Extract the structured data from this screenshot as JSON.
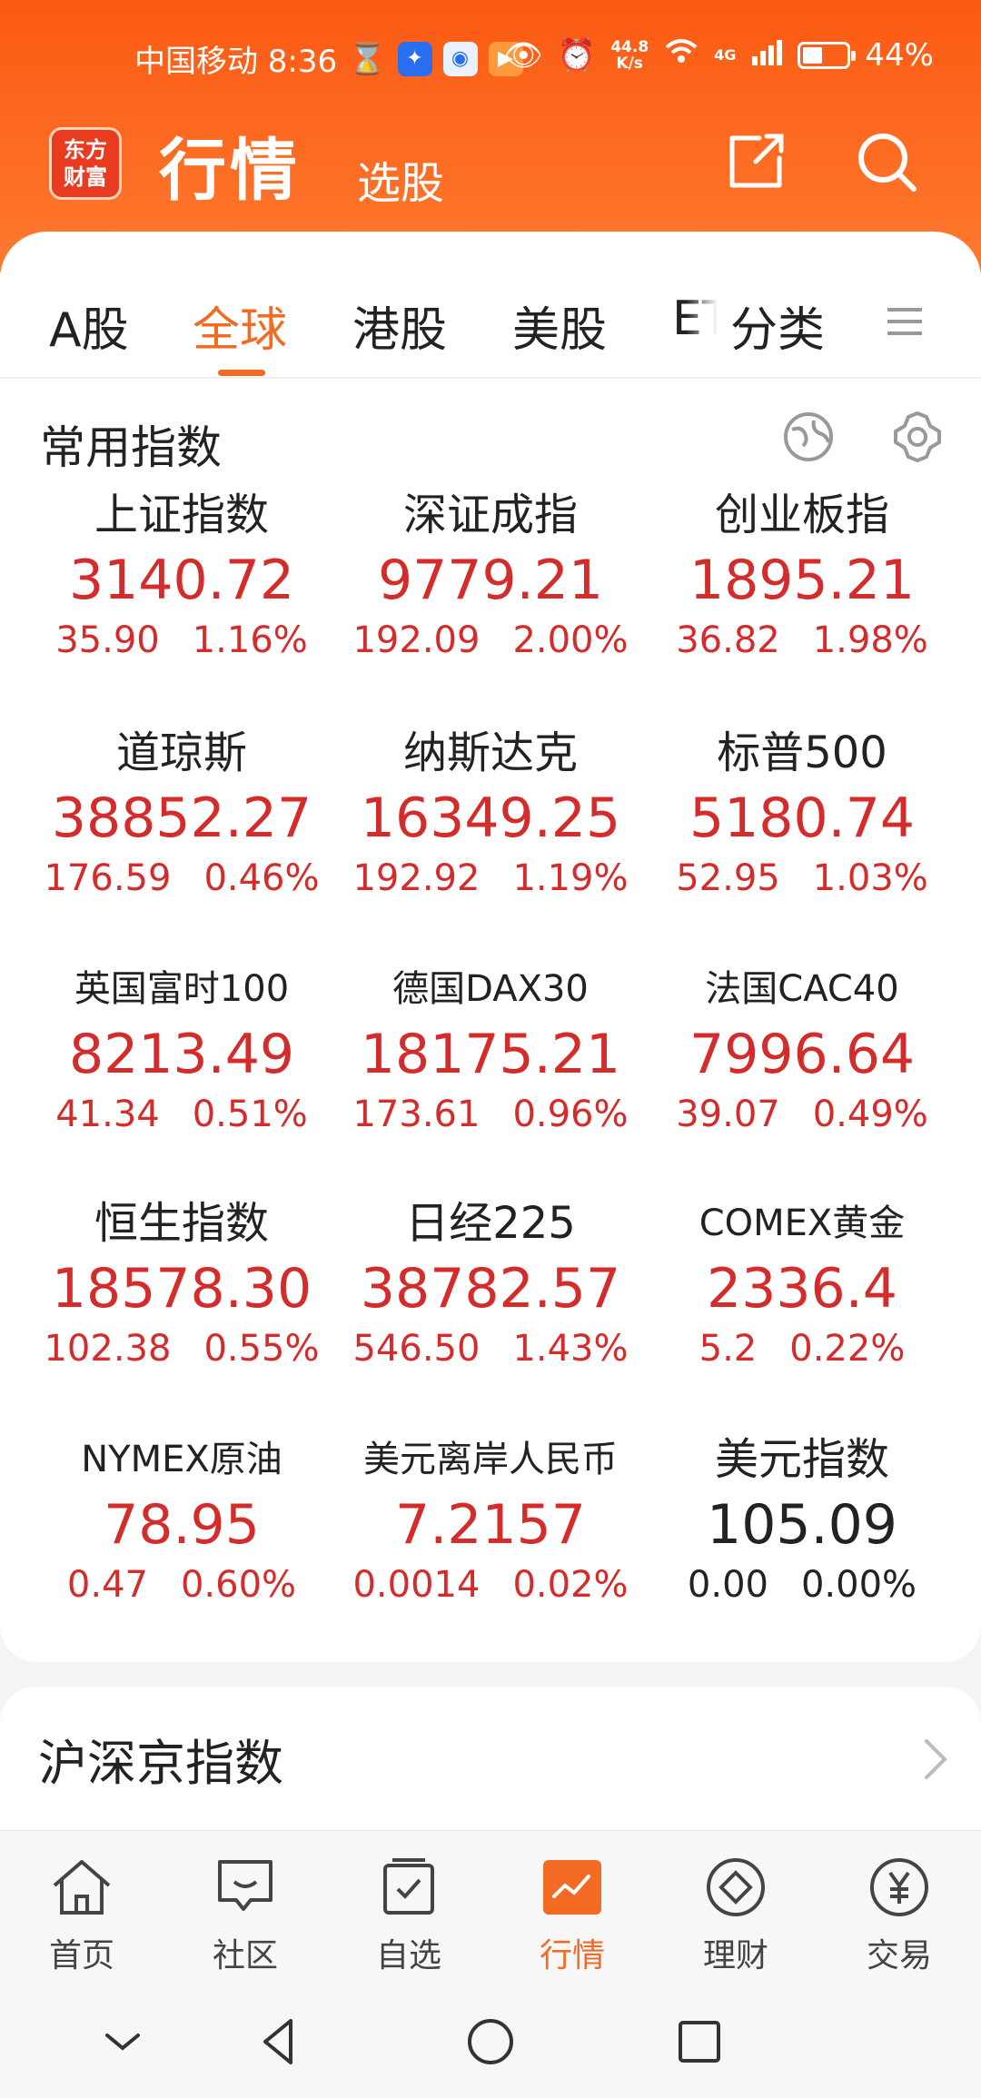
{
  "status_bar": {
    "carrier_time": "中国移动 8:36",
    "net_speed_value": "44.8",
    "net_speed_unit": "K/s",
    "network": "4G",
    "battery": "44%",
    "battery_level": 0.44
  },
  "header": {
    "logo_line1": "东方",
    "logo_line2": "财富",
    "title": "行情",
    "subtitle": "选股",
    "share_icon": "share-icon",
    "search_icon": "search-icon"
  },
  "tabs": [
    {
      "label": "A股",
      "active": false
    },
    {
      "label": "全球",
      "active": true
    },
    {
      "label": "港股",
      "active": false
    },
    {
      "label": "美股",
      "active": false
    },
    {
      "label": "ET",
      "active": false
    },
    {
      "label": "分类",
      "active": false
    }
  ],
  "section": {
    "title": "常用指数",
    "globe_icon": "globe-icon",
    "settings_icon": "gear-icon"
  },
  "indices": [
    {
      "name": "上证指数",
      "price": "3140.72",
      "change": "35.90",
      "pct": "1.16%"
    },
    {
      "name": "深证成指",
      "price": "9779.21",
      "change": "192.09",
      "pct": "2.00%"
    },
    {
      "name": "创业板指",
      "price": "1895.21",
      "change": "36.82",
      "pct": "1.98%"
    },
    {
      "name": "道琼斯",
      "price": "38852.27",
      "change": "176.59",
      "pct": "0.46%"
    },
    {
      "name": "纳斯达克",
      "price": "16349.25",
      "change": "192.92",
      "pct": "1.19%"
    },
    {
      "name": "标普500",
      "price": "5180.74",
      "change": "52.95",
      "pct": "1.03%"
    },
    {
      "name": "英国富时100",
      "price": "8213.49",
      "change": "41.34",
      "pct": "0.51%"
    },
    {
      "name": "德国DAX30",
      "price": "18175.21",
      "change": "173.61",
      "pct": "0.96%"
    },
    {
      "name": "法国CAC40",
      "price": "7996.64",
      "change": "39.07",
      "pct": "0.49%"
    },
    {
      "name": "恒生指数",
      "price": "18578.30",
      "change": "102.38",
      "pct": "0.55%"
    },
    {
      "name": "日经225",
      "price": "38782.57",
      "change": "546.50",
      "pct": "1.43%"
    },
    {
      "name": "COMEX黄金",
      "price": "2336.4",
      "change": "5.2",
      "pct": "0.22%"
    },
    {
      "name": "NYMEX原油",
      "price": "78.95",
      "change": "0.47",
      "pct": "0.60%"
    },
    {
      "name": "美元离岸人民币",
      "price": "7.2157",
      "change": "0.0014",
      "pct": "0.02%"
    },
    {
      "name": "美元指数",
      "price": "105.09",
      "change": "0.00",
      "pct": "0.00%"
    }
  ],
  "second_section": {
    "title": "沪深京指数"
  },
  "bottom_nav": [
    {
      "label": "首页",
      "icon": "home-icon",
      "active": false
    },
    {
      "label": "社区",
      "icon": "community-icon",
      "active": false
    },
    {
      "label": "自选",
      "icon": "watchlist-icon",
      "active": false
    },
    {
      "label": "行情",
      "icon": "market-icon",
      "active": true
    },
    {
      "label": "理财",
      "icon": "wealth-icon",
      "active": false
    },
    {
      "label": "交易",
      "icon": "trade-icon",
      "active": false
    }
  ],
  "colors": {
    "brand": "#fb5a14",
    "up": "#d42b2b",
    "active_tab": "#f36b22"
  }
}
